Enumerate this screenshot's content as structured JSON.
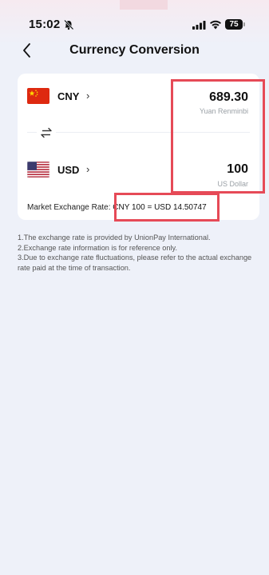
{
  "status": {
    "time": "15:02",
    "battery": "75"
  },
  "nav": {
    "title": "Currency Conversion"
  },
  "converter": {
    "from": {
      "code": "CNY",
      "amount": "689.30",
      "name": "Yuan Renminbi"
    },
    "to": {
      "code": "USD",
      "amount": "100",
      "name": "US Dollar"
    },
    "rate_label": "Market Exchange Rate:",
    "rate_value": "CNY 100 = USD 14.50747"
  },
  "notes": [
    "1.The exchange rate is provided by UnionPay International.",
    "2.Exchange rate information is for reference only.",
    "3.Due to exchange rate fluctuations, please refer to the actual exchange rate paid at the time of transaction."
  ],
  "colors": {
    "background": "#eef1f9",
    "card": "#ffffff",
    "highlight": "#e64a57"
  }
}
